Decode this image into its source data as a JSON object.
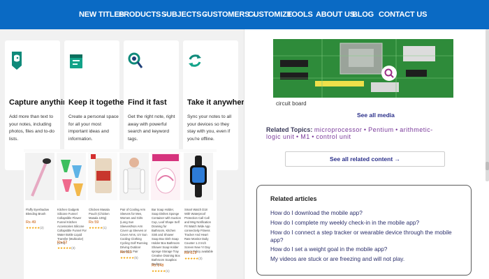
{
  "nav": {
    "items": [
      {
        "label": "NEW TITLES",
        "dropdown": false
      },
      {
        "label": "PRODUCTS",
        "dropdown": true
      },
      {
        "label": "SUBJECTS",
        "dropdown": true
      },
      {
        "label": "CUSTOMERS",
        "dropdown": true
      },
      {
        "label": "CUSTOMIZE",
        "dropdown": false
      },
      {
        "label": "TOOLS",
        "dropdown": false
      },
      {
        "label": "ABOUT US",
        "dropdown": false
      },
      {
        "label": "BLOG",
        "dropdown": false
      },
      {
        "label": "CONTACT US",
        "dropdown": false
      }
    ],
    "background": "#0a6ac4"
  },
  "features": [
    {
      "icon": "elephant-note-icon",
      "title": "Capture anything",
      "desc": "Add more than text to your notes, including photos, files and to-do lists."
    },
    {
      "icon": "notebook-icon",
      "title": "Keep it together",
      "desc": "Create a personal space for all your most important ideas and information."
    },
    {
      "icon": "magnifier-icon",
      "title": "Find it fast",
      "desc": "Get the right note, right away with powerful search and keyword tags."
    },
    {
      "icon": "sync-icon",
      "title": "Take it anywhere",
      "desc": "Sync your notes to all your devices so they stay with you, even if you're offline."
    }
  ],
  "products": [
    {
      "title": "Fluffy Eyeshadow Blending Brush",
      "price": "Rs 49",
      "stars": "★★★★★",
      "reviews": "(2)"
    },
    {
      "title": "Kitchen Gadgets Silicone Funnel Collapsible Flower Funnel Kitchen Accessories Silicone Collapsible Funnel For Water Bottle Liquid Transfer (Multicolor) (1 Pc)",
      "price": "Rs 62",
      "stars": "★★★★★",
      "reviews": "(3)"
    },
    {
      "title": "Chicken Masala Pouch (Chicken Masala 100g)",
      "price": "Rs 59",
      "stars": "★★★★★",
      "reviews": "(1)"
    },
    {
      "title": "Pair of Cooling Arm Sleeves for Men, Women and Girls (Long Sun Sleeves/Non Arm Cover up Sleeves or Cover Arms, UV Sun Cooling Clothing Cycling Golf Running Driving Outdoor Sports) 1 Pair",
      "price": "Rs 111",
      "stars": "★★★★★",
      "reviews": "(5)"
    },
    {
      "title": "Bar Soap Holder, Soap Dishes Sponge Container with Suction Cup, Leaf Shape Self Draining for Bathroom, Kitchen Sink and Shower Soap Box Dish Soap Holder Box Bathroom Shower Soap Holder sponge Storage Tray Creative Draining Box Bathroom Soapbox Gadget",
      "price": "Rs 148",
      "stars": "★★★★★",
      "reviews": "(1)"
    },
    {
      "title": "Smart Watch D18 With Waterproof Protection Call Call and Msg Notification Fit Watch Wide App connectivity Fitness Tracker And Heart Rate Monitor Daily Counter 1.3 Inch Screen New Yr Day return Policy available",
      "price": "Rs 619",
      "stars": "★★★★★",
      "reviews": "(3)"
    }
  ],
  "media": {
    "caption": "circuit board",
    "see_all": "See all media"
  },
  "related_topics": {
    "label": "Related Topics:",
    "links": [
      "microprocessor",
      "Pentium",
      "arithmetic-logic unit",
      "M1",
      "control unit"
    ],
    "separator": "•"
  },
  "see_related": "See all related content →",
  "related_articles": {
    "heading": "Related articles",
    "items": [
      "How do I download the mobile app?",
      "How do I complete my weekly check-in in the mobile app?",
      "How do I connect a step tracker or wearable device through the mobile app?",
      "How do I set a weight goal in the mobile app?",
      "My videos are stuck or are freezing and will not play."
    ]
  }
}
